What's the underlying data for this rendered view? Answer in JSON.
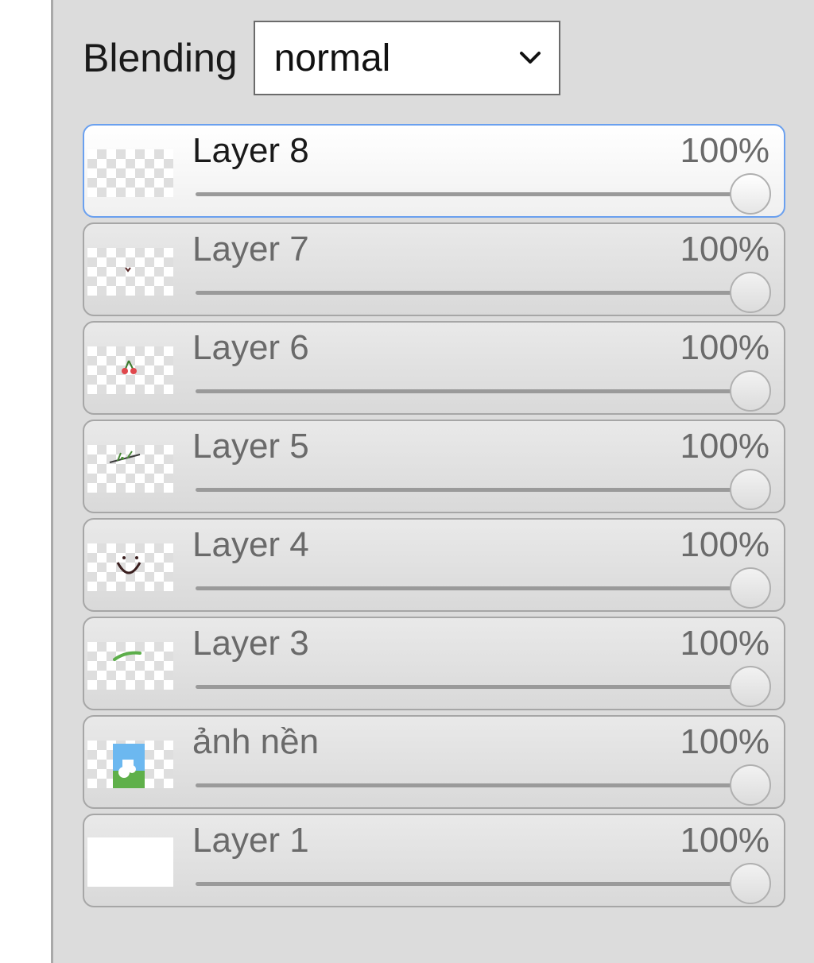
{
  "blending": {
    "label": "Blending",
    "selected": "normal"
  },
  "layers": [
    {
      "name": "Layer 8",
      "opacity_text": "100%",
      "opacity": 1.0,
      "active": true,
      "thumb": "empty"
    },
    {
      "name": "Layer 7",
      "opacity_text": "100%",
      "opacity": 1.0,
      "active": false,
      "thumb": "tiny-mouth"
    },
    {
      "name": "Layer 6",
      "opacity_text": "100%",
      "opacity": 1.0,
      "active": false,
      "thumb": "cherries"
    },
    {
      "name": "Layer 5",
      "opacity_text": "100%",
      "opacity": 1.0,
      "active": false,
      "thumb": "branch"
    },
    {
      "name": "Layer 4",
      "opacity_text": "100%",
      "opacity": 1.0,
      "active": false,
      "thumb": "smile"
    },
    {
      "name": "Layer 3",
      "opacity_text": "100%",
      "opacity": 1.0,
      "active": false,
      "thumb": "green-stroke"
    },
    {
      "name": "ảnh nền",
      "opacity_text": "100%",
      "opacity": 1.0,
      "active": false,
      "thumb": "background-photo"
    },
    {
      "name": "Layer 1",
      "opacity_text": "100%",
      "opacity": 1.0,
      "active": false,
      "thumb": "white-fill"
    }
  ],
  "colors": {
    "active_border": "#6aa0ef",
    "panel_bg": "#dcdcdc"
  }
}
